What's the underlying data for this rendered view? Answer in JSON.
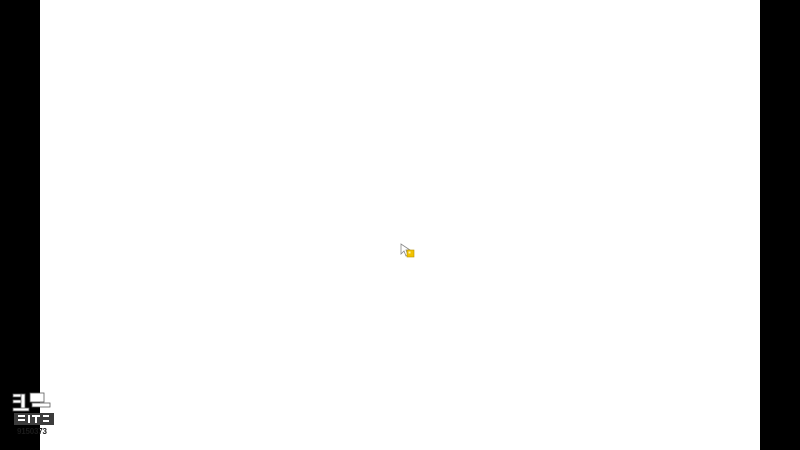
{
  "screen": {
    "background": "#ffffff",
    "letterbox": "#000000"
  },
  "cursor": {
    "icon": "busy-cursor-icon",
    "accent": "#f2c200"
  },
  "watermark": {
    "logo": "douyu-logo",
    "room_id": "9150373"
  }
}
